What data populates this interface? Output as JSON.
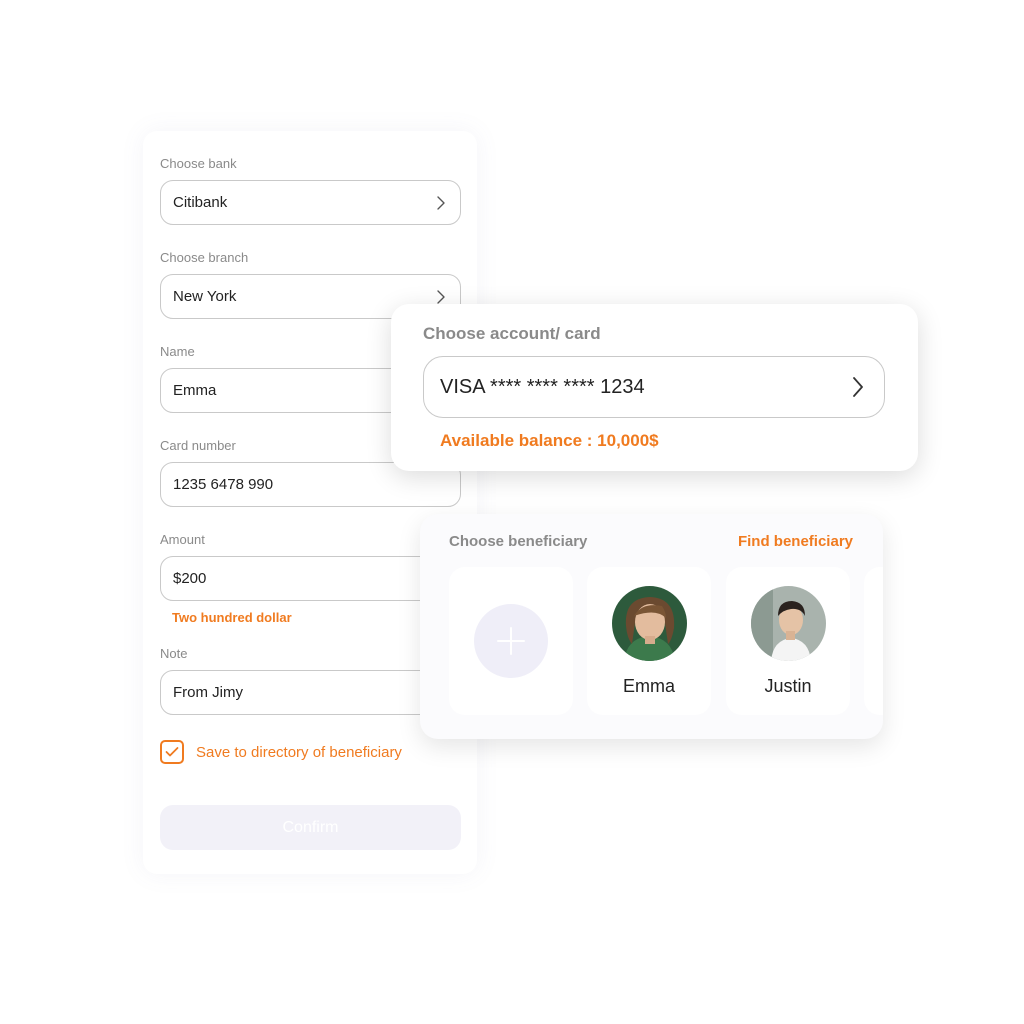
{
  "form": {
    "bank": {
      "label": "Choose bank",
      "value": "Citibank"
    },
    "branch": {
      "label": "Choose branch",
      "value": "New York"
    },
    "name": {
      "label": "Name",
      "value": "Emma"
    },
    "card_number": {
      "label": "Card number",
      "value": "1235 6478 990"
    },
    "amount": {
      "label": "Amount",
      "value": "$200",
      "hint": "Two hundred dollar"
    },
    "note": {
      "label": "Note",
      "value": "From Jimy"
    },
    "save_checkbox": {
      "label": "Save to directory of beneficiary",
      "checked": true
    },
    "confirm_label": "Confirm"
  },
  "account": {
    "title": "Choose account/ card",
    "value": "VISA **** **** **** 1234",
    "balance": "Available balance : 10,000$"
  },
  "beneficiary": {
    "title": "Choose beneficiary",
    "find_label": "Find beneficiary",
    "add_icon": "plus-icon",
    "people": [
      {
        "name": "Emma"
      },
      {
        "name": "Justin"
      }
    ]
  },
  "colors": {
    "accent": "#f07b20",
    "label_gray": "#8a8a8a",
    "border": "#c9c9c9",
    "disabled_button": "#f2f1f8",
    "add_circle": "#efeef8"
  }
}
